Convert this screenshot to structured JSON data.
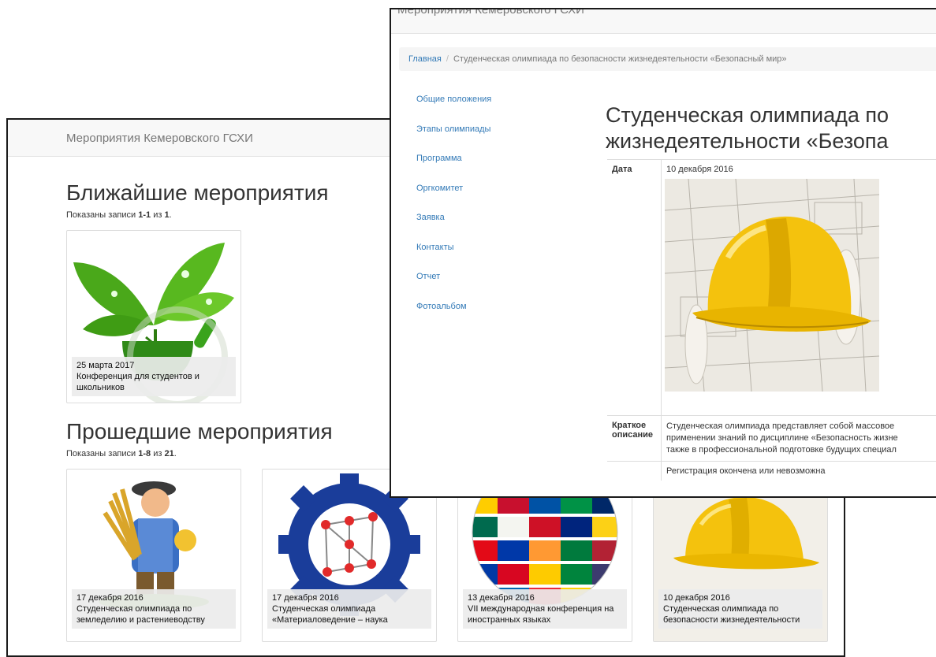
{
  "back_window": {
    "brand": "Мероприятия Кемеровского ГСХИ",
    "upcoming": {
      "heading": "Ближайшие мероприятия",
      "summary_prefix": "Показаны записи ",
      "summary_range": "1-1",
      "summary_of": " из ",
      "summary_total": "1",
      "summary_suffix": ".",
      "cards": [
        {
          "date": "25 марта 2017",
          "title": "Конференция для студентов и школьников",
          "icon": "green-leaves-mortar-image"
        }
      ]
    },
    "past": {
      "heading": "Прошедшие мероприятия",
      "summary_prefix": "Показаны записи ",
      "summary_range": "1-8",
      "summary_of": " из ",
      "summary_total": "21",
      "summary_suffix": ".",
      "cards": [
        {
          "date": "17 декабря 2016",
          "title": "Студенческая олимпиада по земледелию и растениеводству",
          "icon": "farmer-wheat-image"
        },
        {
          "date": "17 декабря 2016",
          "title": "Студенческая олимпиада «Материаловедение – наука",
          "icon": "gear-lattice-image"
        },
        {
          "date": "13 декабря 2016",
          "title": "VII международная конференция на иностранных языках",
          "icon": "flag-globe-image"
        },
        {
          "date": "10 декабря 2016",
          "title": "Студенческая олимпиада по безопасности жизнедеятельности",
          "icon": "hardhat-image"
        }
      ]
    }
  },
  "front_window": {
    "brand": "Мероприятия Кемеровского ГСХИ",
    "breadcrumb": {
      "home": "Главная",
      "separator": "/",
      "current": "Студенческая олимпиада по безопасности жизнедеятельности «Безопасный мир»"
    },
    "sidenav": [
      "Общие положения",
      "Этапы олимпиады",
      "Программа",
      "Оргкомитет",
      "Заявка",
      "Контакты",
      "Отчет",
      "Фотоальбом"
    ],
    "title_line1": "Студенческая олимпиада по",
    "title_line2": "жизнедеятельности «Безопа",
    "table": {
      "date_label": "Дата",
      "date_value": "10 декабря 2016",
      "image_icon": "yellow-hardhat-blueprints-image",
      "desc_label_line1": "Краткое",
      "desc_label_line2": "описание",
      "desc_line1": "Студенческая олимпиада представляет собой массовое",
      "desc_line2": "применении знаний по дисциплине «Безопасность жизне",
      "desc_line3": "также в профессиональной подготовке будущих специал",
      "registration": "Регистрация окончена или невозможна"
    }
  },
  "colors": {
    "link": "#337ab7",
    "navbar_bg": "#f8f8f8",
    "helmet_yellow": "#f4c20d"
  }
}
